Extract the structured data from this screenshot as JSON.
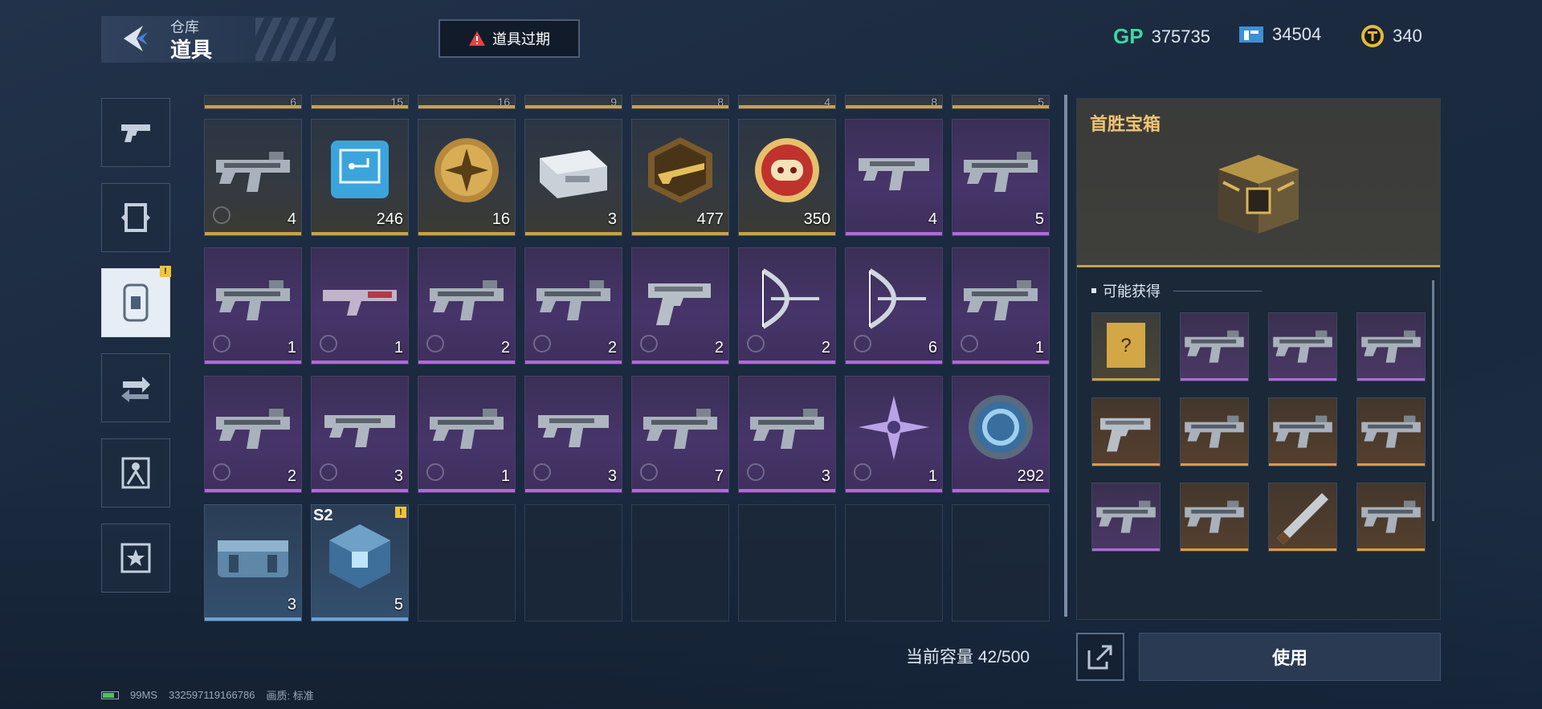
{
  "header": {
    "subtitle": "仓库",
    "title": "道具",
    "expired_button": "道具过期"
  },
  "currencies": [
    {
      "icon": "gp-icon",
      "label": "GP",
      "value": "375735"
    },
    {
      "icon": "ticket-icon",
      "value": "34504"
    },
    {
      "icon": "coin-icon",
      "value": "340"
    }
  ],
  "sidenav": [
    {
      "icon": "pistol-icon",
      "active": false
    },
    {
      "icon": "frame-icon",
      "active": false
    },
    {
      "icon": "card-icon",
      "active": true,
      "warning": "!"
    },
    {
      "icon": "exchange-icon",
      "active": false
    },
    {
      "icon": "character-icon",
      "active": false
    },
    {
      "icon": "star-icon",
      "active": false
    }
  ],
  "top_partial_row": [
    "6",
    "15",
    "16",
    "9",
    "8",
    "4",
    "8",
    "5"
  ],
  "inventory": [
    [
      {
        "rarity": "gold",
        "icon": "rifle-icon",
        "qty": "4",
        "timed": true
      },
      {
        "rarity": "gold",
        "icon": "chip-card-icon",
        "qty": "246"
      },
      {
        "rarity": "gold",
        "icon": "gold-medal-icon",
        "qty": "16"
      },
      {
        "rarity": "gold",
        "icon": "silver-case-icon",
        "qty": "3"
      },
      {
        "rarity": "gold",
        "icon": "gold-badge-icon",
        "qty": "477"
      },
      {
        "rarity": "gold",
        "icon": "pig-coin-icon",
        "qty": "350",
        "timer": true
      },
      {
        "rarity": "purple",
        "icon": "smg-icon",
        "qty": "4"
      },
      {
        "rarity": "purple",
        "icon": "rifle-icon",
        "qty": "5"
      }
    ],
    [
      {
        "rarity": "purple",
        "icon": "rifle-icon",
        "qty": "1",
        "timed": true
      },
      {
        "rarity": "purple",
        "icon": "shotgun-icon",
        "qty": "1",
        "timed": true
      },
      {
        "rarity": "purple",
        "icon": "rifle-icon",
        "qty": "2",
        "timed": true
      },
      {
        "rarity": "purple",
        "icon": "rifle-icon",
        "qty": "2",
        "timed": true
      },
      {
        "rarity": "purple",
        "icon": "pistol-icon",
        "qty": "2",
        "timed": true
      },
      {
        "rarity": "purple",
        "icon": "bow-icon",
        "qty": "2",
        "timed": true
      },
      {
        "rarity": "purple",
        "icon": "bow-icon",
        "qty": "6",
        "timed": true
      },
      {
        "rarity": "purple",
        "icon": "rifle-icon",
        "qty": "1",
        "timed": true
      }
    ],
    [
      {
        "rarity": "purple",
        "icon": "rifle-icon",
        "qty": "2",
        "timed": true
      },
      {
        "rarity": "purple",
        "icon": "smg-icon",
        "qty": "3",
        "timed": true
      },
      {
        "rarity": "purple",
        "icon": "rifle-icon",
        "qty": "1",
        "timed": true
      },
      {
        "rarity": "purple",
        "icon": "smg-icon",
        "qty": "3",
        "timed": true
      },
      {
        "rarity": "purple",
        "icon": "rifle-icon",
        "qty": "7",
        "timed": true
      },
      {
        "rarity": "purple",
        "icon": "rifle-icon",
        "qty": "3",
        "timed": true
      },
      {
        "rarity": "purple",
        "icon": "shuriken-icon",
        "qty": "1",
        "timed": true
      },
      {
        "rarity": "purple",
        "icon": "blue-token-icon",
        "qty": "292"
      }
    ],
    [
      {
        "rarity": "blue",
        "icon": "supply-crate-icon",
        "qty": "3"
      },
      {
        "rarity": "blue",
        "icon": "s2-cube-icon",
        "qty": "5",
        "tag": "S2",
        "warning": "!"
      },
      {
        "rarity": "empty"
      },
      {
        "rarity": "empty"
      },
      {
        "rarity": "empty"
      },
      {
        "rarity": "empty"
      },
      {
        "rarity": "empty"
      },
      {
        "rarity": "empty"
      }
    ]
  ],
  "capacity_label": "当前容量 42/500",
  "detail": {
    "title": "首胜宝箱",
    "rewards_label": "可能获得",
    "rewards": [
      {
        "rarity": "gold",
        "icon": "mystery-weapon-icon"
      },
      {
        "rarity": "purple",
        "icon": "rifle-icon"
      },
      {
        "rarity": "purple",
        "icon": "rifle-icon"
      },
      {
        "rarity": "purple",
        "icon": "rifle-icon"
      },
      {
        "rarity": "orange",
        "icon": "pistol-icon"
      },
      {
        "rarity": "orange",
        "icon": "rifle-icon"
      },
      {
        "rarity": "orange",
        "icon": "rifle-icon"
      },
      {
        "rarity": "orange",
        "icon": "rifle-icon"
      },
      {
        "rarity": "purple",
        "icon": "rifle-icon"
      },
      {
        "rarity": "orange",
        "icon": "rifle-icon"
      },
      {
        "rarity": "orange",
        "icon": "knife-icon"
      },
      {
        "rarity": "orange",
        "icon": "rifle-icon"
      }
    ]
  },
  "use_button": "使用",
  "status": {
    "ping": "99MS",
    "uid": "332597119166786",
    "quality_label": "画质: 标准"
  },
  "colors": {
    "gold": "#c9a24a",
    "purple": "#b06ad9",
    "blue": "#6ea3d6",
    "warning": "#f0c43a",
    "gp_green": "#3fd6a0"
  }
}
